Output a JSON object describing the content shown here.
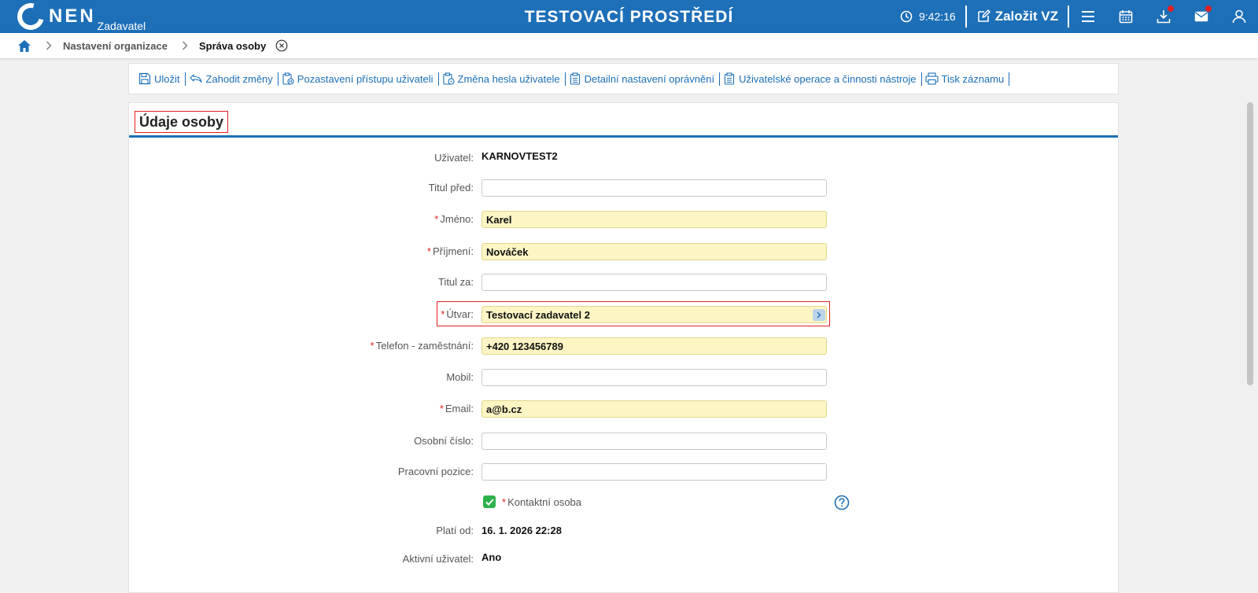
{
  "header": {
    "logo_text": "NEN",
    "logo_sub": "Zadavatel",
    "env_title": "TESTOVACÍ PROSTŘEDÍ",
    "clock": "9:42:16",
    "create_label": "Založit VZ"
  },
  "breadcrumb": {
    "items": [
      "Nastavení organizace"
    ],
    "current": "Správa osoby"
  },
  "toolbar": {
    "save": "Uložit",
    "discard": "Zahodit změny",
    "suspend": "Pozastavení přístupu uživateli",
    "password": "Změna hesla uživatele",
    "permissions": "Detailní nastavení oprávnění",
    "operations": "Uživatelské operace a činnosti nástroje",
    "print": "Tisk záznamu"
  },
  "panel": {
    "title": "Údaje osoby"
  },
  "form": {
    "user_label": "Uživatel:",
    "user_value": "KARNOVTEST2",
    "title_before_label": "Titul před:",
    "title_before_value": "",
    "first_name_label": "Jméno:",
    "first_name_value": "Karel",
    "last_name_label": "Příjmení:",
    "last_name_value": "Nováček",
    "title_after_label": "Titul za:",
    "title_after_value": "",
    "unit_label": "Útvar:",
    "unit_value": "Testovací zadavatel 2",
    "phone_label": "Telefon - zaměstnání:",
    "phone_value": "+420 123456789",
    "mobile_label": "Mobil:",
    "mobile_value": "",
    "email_label": "Email:",
    "email_value": "a@b.cz",
    "personal_no_label": "Osobní číslo:",
    "personal_no_value": "",
    "position_label": "Pracovní pozice:",
    "position_value": "",
    "contact_label": "Kontaktní osoba",
    "contact_checked": true,
    "valid_from_label": "Platí od:",
    "valid_from_value": "16. 1. 2026 22:28",
    "active_label": "Aktivní uživatel:",
    "active_value": "Ano",
    "required_mark": "*"
  },
  "colors": {
    "brand": "#1d6fb8",
    "required_field": "#fdf5c4",
    "required_mark": "#e02020",
    "checkbox": "#2db24a"
  }
}
